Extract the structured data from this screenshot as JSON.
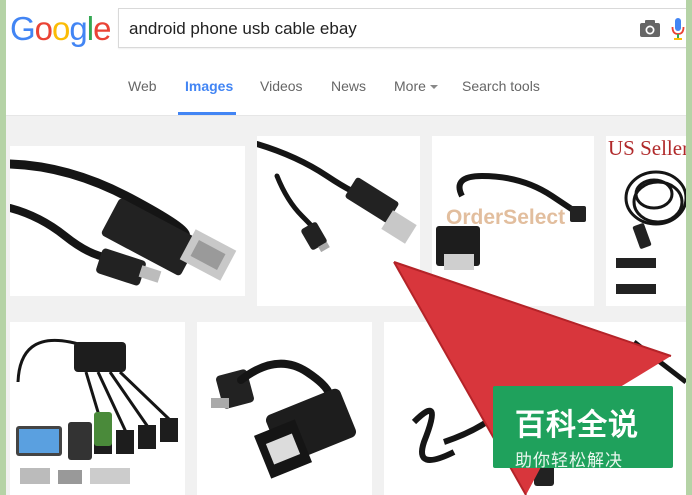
{
  "header": {
    "logo_letters": [
      "G",
      "o",
      "o",
      "g",
      "l",
      "e"
    ],
    "search": {
      "value": "android phone usb cable ebay",
      "placeholder": ""
    },
    "icons": [
      "camera-icon",
      "microphone-icon"
    ]
  },
  "tabs": [
    {
      "label": "Web",
      "active": false
    },
    {
      "label": "Images",
      "active": true
    },
    {
      "label": "Videos",
      "active": false
    },
    {
      "label": "News",
      "active": false
    },
    {
      "label": "More",
      "active": false,
      "has_dropdown": true
    },
    {
      "label": "Search tools",
      "active": false
    }
  ],
  "results": {
    "thumbnails": [
      {
        "depicts": "usb-a to micro-usb cable"
      },
      {
        "depicts": "usb-a to micro-usb cable"
      },
      {
        "depicts": "micro-usb otg adapter",
        "text": "OrderSelect"
      },
      {
        "depicts": "coiled usb cables",
        "text": "US Seller"
      },
      {
        "depicts": "otg hub with devices"
      },
      {
        "depicts": "micro-usb otg adapter"
      },
      {
        "depicts": "coiled cable"
      },
      {
        "depicts": "cable"
      }
    ]
  },
  "overlay": {
    "arrow_color": "#d8363c",
    "badge_title": "百科全说",
    "badge_subtitle": "助你轻松解决",
    "badge_color": "#1fa15c"
  },
  "colors": {
    "accent": "#4285f4",
    "frame_border": "#b5d3a6"
  }
}
